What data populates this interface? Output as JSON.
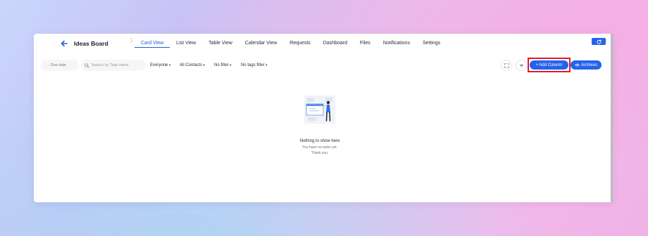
{
  "header": {
    "title": "Ideas Board",
    "kebab": "⋮",
    "tabs": [
      {
        "label": "Card View",
        "active": true
      },
      {
        "label": "List View"
      },
      {
        "label": "Table View"
      },
      {
        "label": "Calendar View"
      },
      {
        "label": "Requests"
      },
      {
        "label": "Dashboard"
      },
      {
        "label": "Files"
      },
      {
        "label": "Notifications"
      },
      {
        "label": "Settings"
      }
    ],
    "refresh_icon": "refresh-icon"
  },
  "filters": {
    "due_date": "Due date",
    "search_placeholder": "Search by Task name",
    "assignee": "Everyone",
    "contacts": "All Contacts",
    "filter": "No filter",
    "tags": "No tags filter",
    "caret": "▾",
    "add_column": "+ Add Column",
    "archives": "Archives",
    "expand_icon": "expand-icon",
    "sort_icon": "sort-icon"
  },
  "empty_state": {
    "title": "Nothing to show here",
    "subtitle": "You have no tasks yet.",
    "thanks": "Thank you."
  },
  "colors": {
    "accent": "#2563eb",
    "highlight": "#e0182b",
    "active_tab": "#1f5fd6"
  }
}
